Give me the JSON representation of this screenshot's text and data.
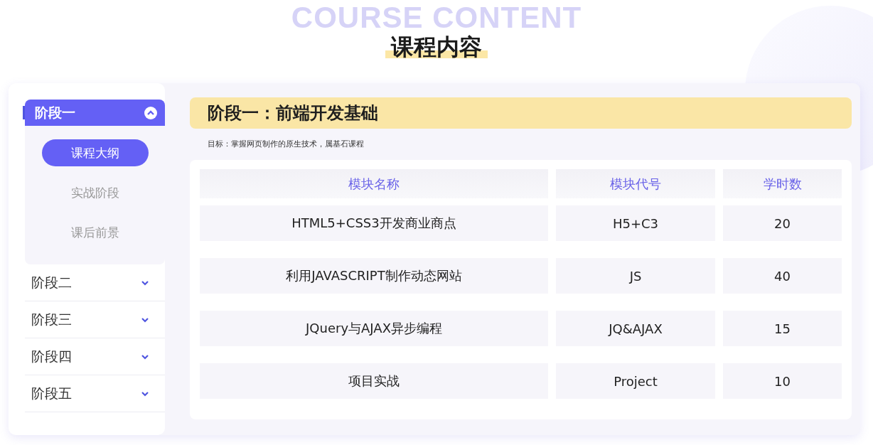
{
  "header": {
    "background_title": "COURSE CONTENT",
    "title": "课程内容"
  },
  "sidebar": {
    "stages": [
      {
        "label": "阶段一",
        "selected": true,
        "expanded": true,
        "children": [
          {
            "label": "课程大纲",
            "selected": true
          },
          {
            "label": "实战阶段",
            "selected": false
          },
          {
            "label": "课后前景",
            "selected": false
          }
        ]
      },
      {
        "label": "阶段二",
        "selected": false,
        "expanded": false
      },
      {
        "label": "阶段三",
        "selected": false,
        "expanded": false
      },
      {
        "label": "阶段四",
        "selected": false,
        "expanded": false
      },
      {
        "label": "阶段五",
        "selected": false,
        "expanded": false
      }
    ]
  },
  "content": {
    "title": "阶段一：前端开发基础",
    "goal": "目标：掌握网页制作的原生技术，属基石课程",
    "table": {
      "columns": [
        "模块名称",
        "模块代号",
        "学时数"
      ],
      "rows": [
        [
          "HTML5+CSS3开发商业商点",
          "H5+C3",
          "20"
        ],
        [
          "利用JAVASCRIPT制作动态网站",
          "JS",
          "40"
        ],
        [
          "JQuery与AJAX异步编程",
          "JQ&AJAX",
          "15"
        ],
        [
          "项目实战",
          "Project",
          "10"
        ]
      ]
    }
  }
}
